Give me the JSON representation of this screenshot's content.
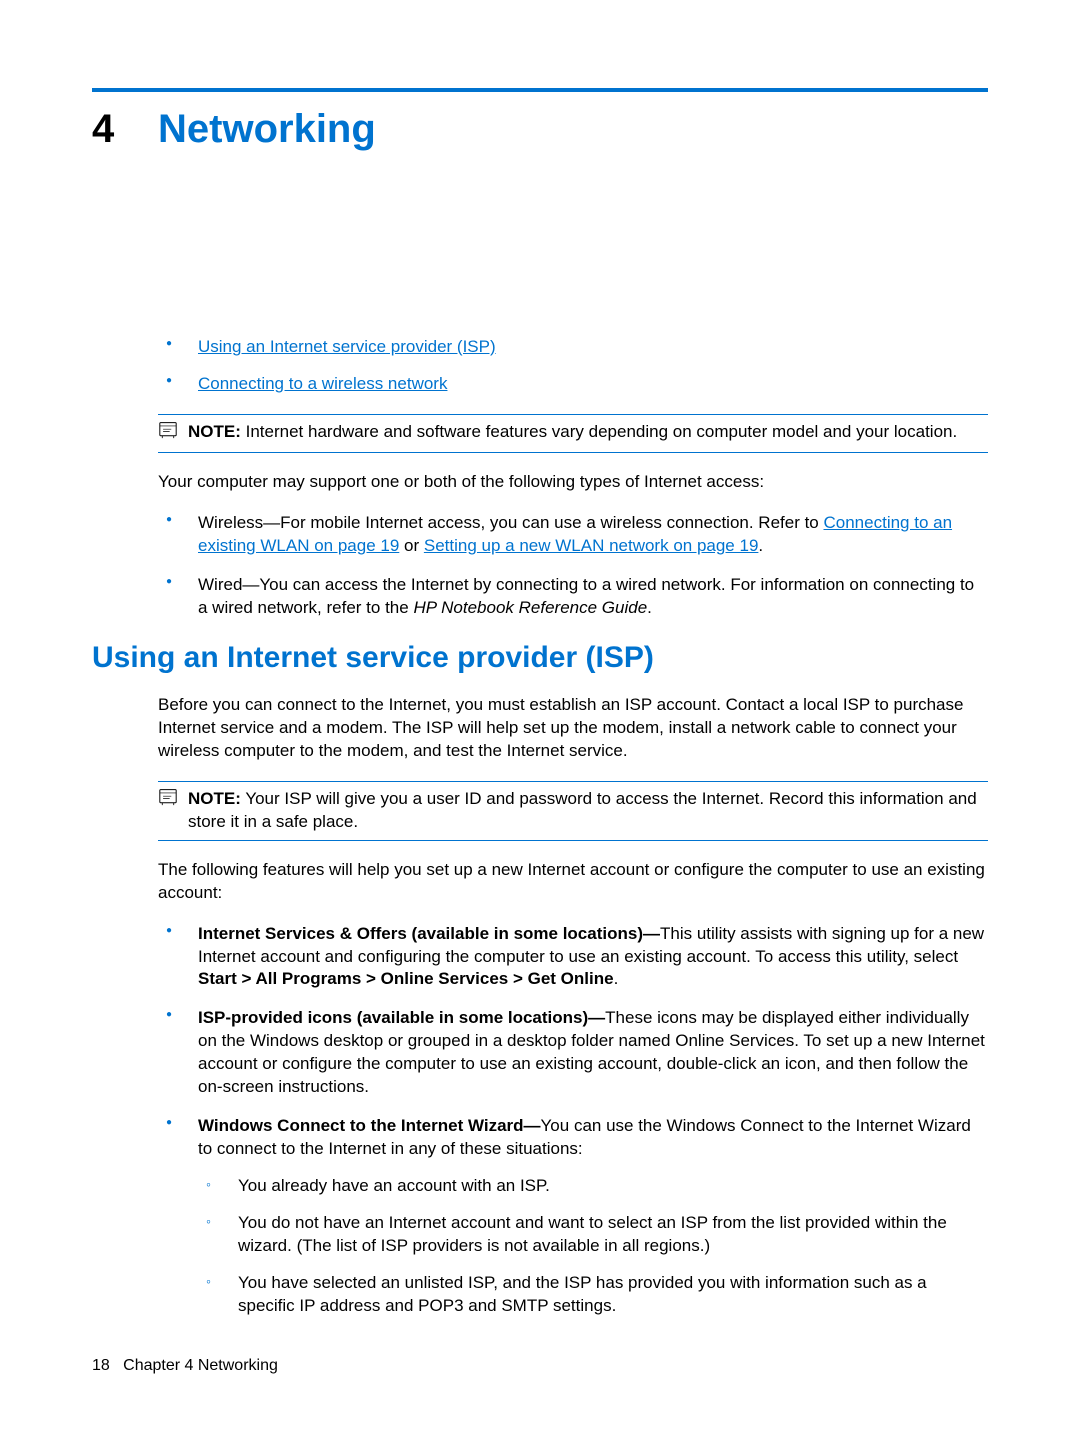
{
  "chapter": {
    "number": "4",
    "title": "Networking"
  },
  "toc": {
    "items": [
      "Using an Internet service provider (ISP)",
      "Connecting to a wireless network"
    ]
  },
  "note1": {
    "label": "NOTE:",
    "text": "Internet hardware and software features vary depending on computer model and your location."
  },
  "intro": {
    "para": "Your computer may support one or both of the following types of Internet access:",
    "wireless": {
      "prefix": "Wireless—For mobile Internet access, you can use a wireless connection. Refer to ",
      "link1": "Connecting to an existing WLAN on page 19",
      "middle": " or ",
      "link2": "Setting up a new WLAN network on page 19",
      "suffix": "."
    },
    "wired": {
      "text": "Wired—You can access the Internet by connecting to a wired network. For information on connecting to a wired network, refer to the ",
      "italic": "HP Notebook Reference Guide",
      "suffix": "."
    }
  },
  "section": {
    "title": "Using an Internet service provider (ISP)",
    "para1": "Before you can connect to the Internet, you must establish an ISP account. Contact a local ISP to purchase Internet service and a modem. The ISP will help set up the modem, install a network cable to connect your wireless computer to the modem, and test the Internet service."
  },
  "note2": {
    "label": "NOTE:",
    "text": "Your ISP will give you a user ID and password to access the Internet. Record this information and store it in a safe place."
  },
  "features": {
    "para": "The following features will help you set up a new Internet account or configure the computer to use an existing account:",
    "item1": {
      "bold": "Internet Services & Offers (available in some locations)—",
      "text": "This utility assists with signing up for a new Internet account and configuring the computer to use an existing account. To access this utility, select ",
      "bold2": "Start > All Programs > Online Services > Get Online",
      "suffix": "."
    },
    "item2": {
      "bold": "ISP-provided icons (available in some locations)—",
      "text": "These icons may be displayed either individually on the Windows desktop or grouped in a desktop folder named Online Services. To set up a new Internet account or configure the computer to use an existing account, double-click an icon, and then follow the on-screen instructions."
    },
    "item3": {
      "bold": "Windows Connect to the Internet Wizard—",
      "text": "You can use the Windows Connect to the Internet Wizard to connect to the Internet in any of these situations:",
      "sub": [
        "You already have an account with an ISP.",
        "You do not have an Internet account and want to select an ISP from the list provided within the wizard. (The list of ISP providers is not available in all regions.)",
        "You have selected an unlisted ISP, and the ISP has provided you with information such as a specific IP address and POP3 and SMTP settings."
      ]
    }
  },
  "footer": {
    "page": "18",
    "chapter": "Chapter 4   Networking"
  }
}
